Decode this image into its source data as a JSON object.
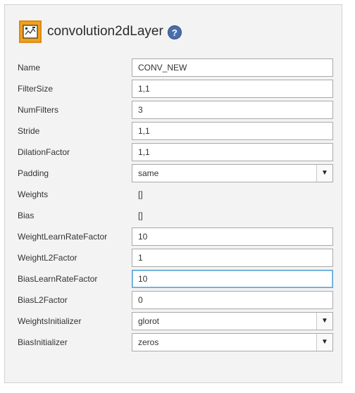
{
  "header": {
    "title": "convolution2dLayer",
    "icon": "layer-icon",
    "help_symbol": "?"
  },
  "properties": [
    {
      "label": "Name",
      "type": "input",
      "value": "CONV_NEW"
    },
    {
      "label": "FilterSize",
      "type": "input",
      "value": "1,1"
    },
    {
      "label": "NumFilters",
      "type": "input",
      "value": "3"
    },
    {
      "label": "Stride",
      "type": "input",
      "value": "1,1"
    },
    {
      "label": "DilationFactor",
      "type": "input",
      "value": "1,1"
    },
    {
      "label": "Padding",
      "type": "select",
      "value": "same"
    },
    {
      "label": "Weights",
      "type": "static",
      "value": "[]"
    },
    {
      "label": "Bias",
      "type": "static",
      "value": "[]"
    },
    {
      "label": "WeightLearnRateFactor",
      "type": "input",
      "value": "10"
    },
    {
      "label": "WeightL2Factor",
      "type": "input",
      "value": "1"
    },
    {
      "label": "BiasLearnRateFactor",
      "type": "input",
      "value": "10",
      "focused": true
    },
    {
      "label": "BiasL2Factor",
      "type": "input",
      "value": "0"
    },
    {
      "label": "WeightsInitializer",
      "type": "select",
      "value": "glorot"
    },
    {
      "label": "BiasInitializer",
      "type": "select",
      "value": "zeros"
    }
  ],
  "colors": {
    "icon_bg": "#f0a020",
    "help_bg": "#4c6ea8",
    "focus_border": "#5aa5d6"
  }
}
